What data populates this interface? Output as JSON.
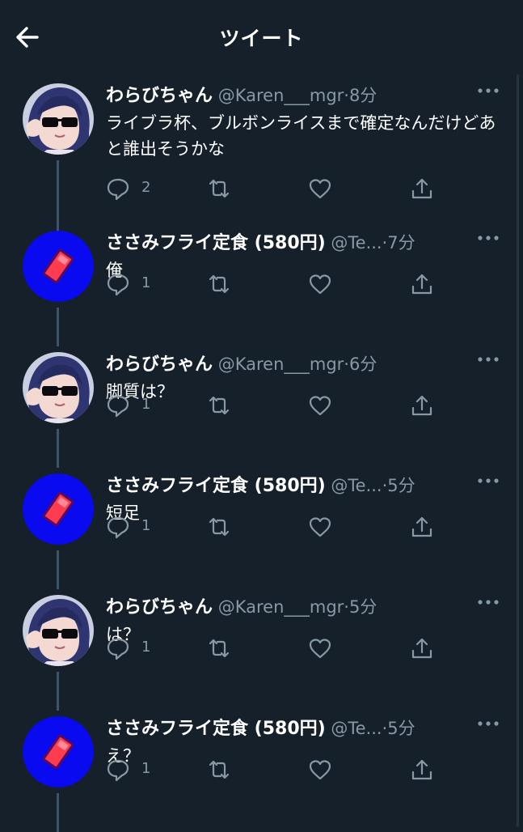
{
  "header": {
    "title": "ツイート"
  },
  "tweets": [
    {
      "author": "わらびちゃん",
      "handle": "@Karen___mgr",
      "sep": "·",
      "time": "8分",
      "text": "ライブラ杯、ブルボンライスまで確定なんだけどあと誰出そうかな",
      "replies": "2",
      "avatar": "girl-avatar"
    },
    {
      "author": "ささみフライ定食 (580円)",
      "handle": "@Te...",
      "sep": "·",
      "time": "7分",
      "text": "俺",
      "replies": "1",
      "avatar": "blue-circle-avatar"
    },
    {
      "author": "わらびちゃん",
      "handle": "@Karen___mgr",
      "sep": "·",
      "time": "6分",
      "text": "脚質は？",
      "replies": "1",
      "avatar": "girl-avatar"
    },
    {
      "author": "ささみフライ定食 (580円)",
      "handle": "@Te...",
      "sep": "·",
      "time": "5分",
      "text": "短足",
      "replies": "1",
      "avatar": "blue-circle-avatar"
    },
    {
      "author": "わらびちゃん",
      "handle": "@Karen___mgr",
      "sep": "·",
      "time": "5分",
      "text": "は？",
      "replies": "1",
      "avatar": "girl-avatar"
    },
    {
      "author": "ささみフライ定食 (580円)",
      "handle": "@Te...",
      "sep": "·",
      "time": "5分",
      "text": "え？",
      "replies": "1",
      "avatar": "blue-circle-avatar"
    }
  ],
  "colors": {
    "background": "#15202b",
    "muted": "#8899a6",
    "thread_line": "#3d5466",
    "blue_avatar": "#0a0af0",
    "tag_red": "#ff3b4f"
  }
}
